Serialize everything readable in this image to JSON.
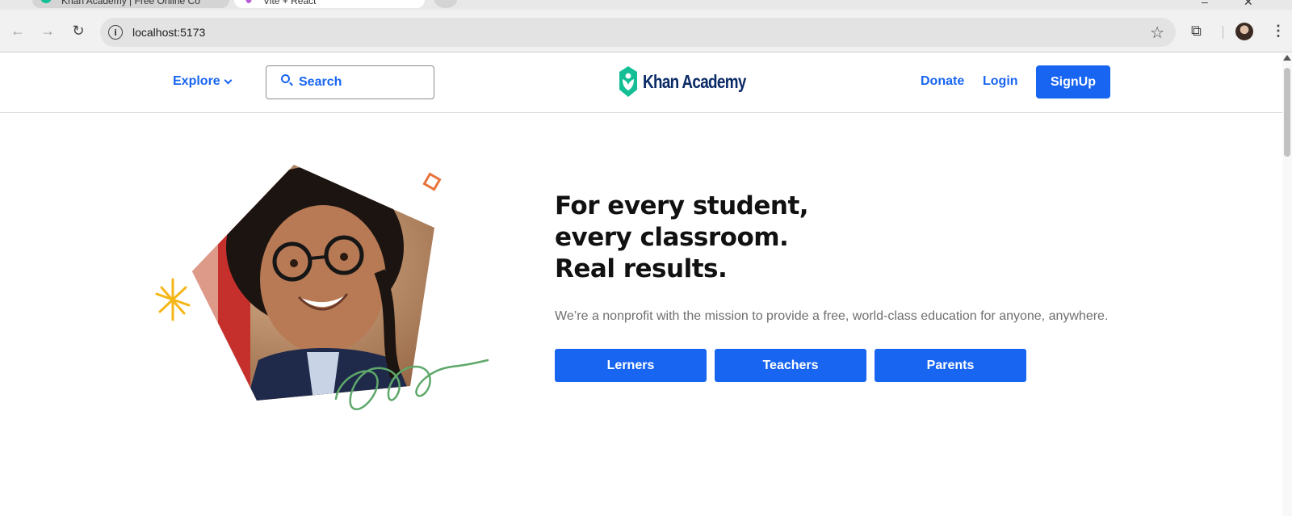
{
  "browser": {
    "tabs": [
      {
        "title": "Khan Academy | Free Online Co",
        "favicon": "khan-leaf-icon"
      },
      {
        "title": "Vite + React",
        "favicon": "vite-icon"
      }
    ],
    "url": "localhost:5173"
  },
  "header": {
    "explore_label": "Explore",
    "search_label": "Search",
    "logo_text": "Khan Academy",
    "donate_label": "Donate",
    "login_label": "Login",
    "signup_label": "SignUp"
  },
  "hero": {
    "headline_lines": [
      "For every student,",
      "every classroom.",
      "Real results."
    ],
    "tagline": "We’re a nonprofit with the mission to provide a free, world-class education for anyone, anywhere.",
    "buttons": [
      "Lerners",
      "Teachers",
      "Parents"
    ]
  },
  "colors": {
    "accent": "#1865f2",
    "logo_green": "#14bf96",
    "logo_navy": "#0a2a66",
    "deco_orange": "#e8743b",
    "deco_yellow": "#f5b717",
    "deco_green": "#5ea86a"
  }
}
